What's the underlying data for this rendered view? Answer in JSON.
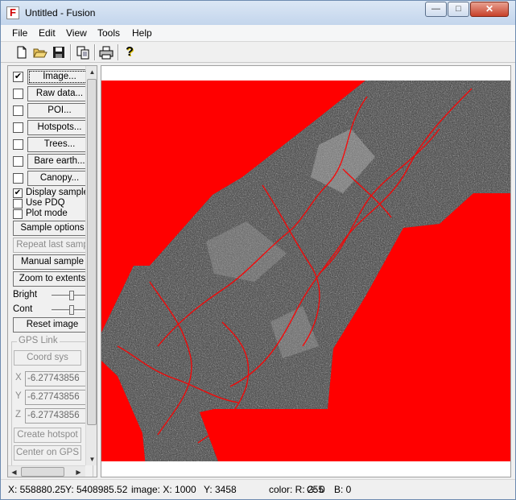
{
  "window": {
    "title": "Untitled - Fusion",
    "app_icon_letter": "F",
    "minimize_glyph": "—",
    "maximize_glyph": "□",
    "close_glyph": "✕"
  },
  "menu": {
    "items": [
      "File",
      "Edit",
      "View",
      "Tools",
      "Help"
    ]
  },
  "toolbar": {
    "icons": [
      "new-document-icon",
      "open-folder-icon",
      "save-icon",
      "copy-icon",
      "print-icon",
      "help-icon"
    ],
    "help_glyph": "?"
  },
  "panel": {
    "layers": [
      {
        "label": "Image...",
        "checked": true
      },
      {
        "label": "Raw data...",
        "checked": false
      },
      {
        "label": "POI...",
        "checked": false
      },
      {
        "label": "Hotspots...",
        "checked": false
      },
      {
        "label": "Trees...",
        "checked": false
      },
      {
        "label": "Bare earth...",
        "checked": false
      },
      {
        "label": "Canopy...",
        "checked": false
      }
    ],
    "check_mark": "✔",
    "options": [
      {
        "label": "Display sample",
        "checked": true
      },
      {
        "label": "Use PDQ",
        "checked": false
      },
      {
        "label": "Plot mode",
        "checked": false
      }
    ],
    "sample_options": "Sample options",
    "repeat_last_sample": "Repeat last samp",
    "manual_sample": "Manual sample",
    "zoom_to_extents": "Zoom to extents",
    "bright_label": "Bright",
    "bright_level": 0.55,
    "cont_label": "Cont",
    "cont_level": 0.55,
    "reset_image": "Reset image",
    "gps_link": {
      "title": "GPS Link",
      "coord_sys": "Coord sys",
      "x_label": "X",
      "y_label": "Y",
      "z_label": "Z",
      "x_value": "-6.27743856",
      "y_value": "-6.27743856",
      "z_value": "-6.27743856",
      "create_hotspot": "Create hotspot",
      "center_on_gps": "Center on GPS"
    }
  },
  "status": {
    "x": "X: 558880.25",
    "y": "Y: 5408985.52",
    "image_x": "image: X:  1000",
    "image_y": "Y:  3458",
    "color_r": "color: R: 255",
    "color_g": "G:  0",
    "color_b": "B:  0"
  },
  "colors": {
    "background_fill": "#ff0000",
    "viewport_bg": "#ffffff"
  }
}
